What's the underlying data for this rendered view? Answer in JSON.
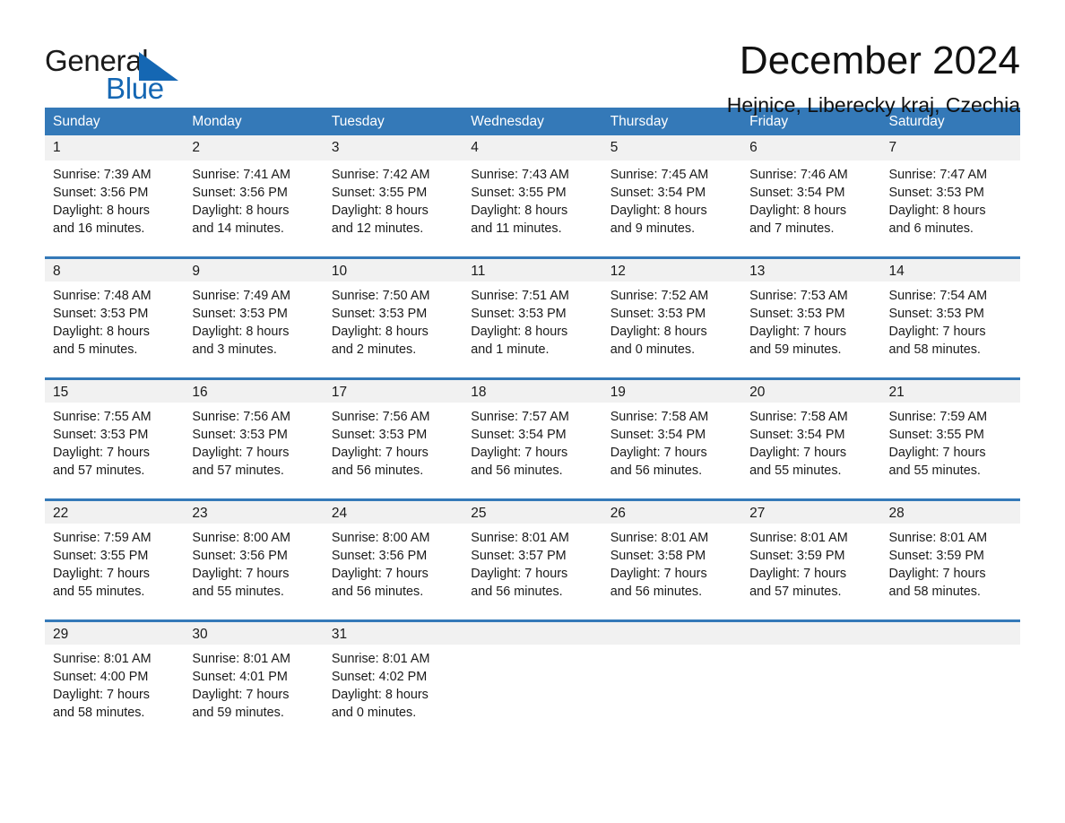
{
  "brand": {
    "name_part1": "General",
    "name_part2": "Blue",
    "triangle_icon": "triangle-icon",
    "accent_color": "#1567b3"
  },
  "header": {
    "title": "December 2024",
    "subtitle": "Hejnice, Liberecky kraj, Czechia"
  },
  "colors": {
    "header_blue": "#3479b8",
    "daynum_band": "#f1f1f1",
    "text": "#1a1a1a"
  },
  "calendar": {
    "weekdays": [
      "Sunday",
      "Monday",
      "Tuesday",
      "Wednesday",
      "Thursday",
      "Friday",
      "Saturday"
    ],
    "weeks": [
      [
        {
          "day": "1",
          "sunrise": "Sunrise: 7:39 AM",
          "sunset": "Sunset: 3:56 PM",
          "daylight_line1": "Daylight: 8 hours",
          "daylight_line2": "and 16 minutes."
        },
        {
          "day": "2",
          "sunrise": "Sunrise: 7:41 AM",
          "sunset": "Sunset: 3:56 PM",
          "daylight_line1": "Daylight: 8 hours",
          "daylight_line2": "and 14 minutes."
        },
        {
          "day": "3",
          "sunrise": "Sunrise: 7:42 AM",
          "sunset": "Sunset: 3:55 PM",
          "daylight_line1": "Daylight: 8 hours",
          "daylight_line2": "and 12 minutes."
        },
        {
          "day": "4",
          "sunrise": "Sunrise: 7:43 AM",
          "sunset": "Sunset: 3:55 PM",
          "daylight_line1": "Daylight: 8 hours",
          "daylight_line2": "and 11 minutes."
        },
        {
          "day": "5",
          "sunrise": "Sunrise: 7:45 AM",
          "sunset": "Sunset: 3:54 PM",
          "daylight_line1": "Daylight: 8 hours",
          "daylight_line2": "and 9 minutes."
        },
        {
          "day": "6",
          "sunrise": "Sunrise: 7:46 AM",
          "sunset": "Sunset: 3:54 PM",
          "daylight_line1": "Daylight: 8 hours",
          "daylight_line2": "and 7 minutes."
        },
        {
          "day": "7",
          "sunrise": "Sunrise: 7:47 AM",
          "sunset": "Sunset: 3:53 PM",
          "daylight_line1": "Daylight: 8 hours",
          "daylight_line2": "and 6 minutes."
        }
      ],
      [
        {
          "day": "8",
          "sunrise": "Sunrise: 7:48 AM",
          "sunset": "Sunset: 3:53 PM",
          "daylight_line1": "Daylight: 8 hours",
          "daylight_line2": "and 5 minutes."
        },
        {
          "day": "9",
          "sunrise": "Sunrise: 7:49 AM",
          "sunset": "Sunset: 3:53 PM",
          "daylight_line1": "Daylight: 8 hours",
          "daylight_line2": "and 3 minutes."
        },
        {
          "day": "10",
          "sunrise": "Sunrise: 7:50 AM",
          "sunset": "Sunset: 3:53 PM",
          "daylight_line1": "Daylight: 8 hours",
          "daylight_line2": "and 2 minutes."
        },
        {
          "day": "11",
          "sunrise": "Sunrise: 7:51 AM",
          "sunset": "Sunset: 3:53 PM",
          "daylight_line1": "Daylight: 8 hours",
          "daylight_line2": "and 1 minute."
        },
        {
          "day": "12",
          "sunrise": "Sunrise: 7:52 AM",
          "sunset": "Sunset: 3:53 PM",
          "daylight_line1": "Daylight: 8 hours",
          "daylight_line2": "and 0 minutes."
        },
        {
          "day": "13",
          "sunrise": "Sunrise: 7:53 AM",
          "sunset": "Sunset: 3:53 PM",
          "daylight_line1": "Daylight: 7 hours",
          "daylight_line2": "and 59 minutes."
        },
        {
          "day": "14",
          "sunrise": "Sunrise: 7:54 AM",
          "sunset": "Sunset: 3:53 PM",
          "daylight_line1": "Daylight: 7 hours",
          "daylight_line2": "and 58 minutes."
        }
      ],
      [
        {
          "day": "15",
          "sunrise": "Sunrise: 7:55 AM",
          "sunset": "Sunset: 3:53 PM",
          "daylight_line1": "Daylight: 7 hours",
          "daylight_line2": "and 57 minutes."
        },
        {
          "day": "16",
          "sunrise": "Sunrise: 7:56 AM",
          "sunset": "Sunset: 3:53 PM",
          "daylight_line1": "Daylight: 7 hours",
          "daylight_line2": "and 57 minutes."
        },
        {
          "day": "17",
          "sunrise": "Sunrise: 7:56 AM",
          "sunset": "Sunset: 3:53 PM",
          "daylight_line1": "Daylight: 7 hours",
          "daylight_line2": "and 56 minutes."
        },
        {
          "day": "18",
          "sunrise": "Sunrise: 7:57 AM",
          "sunset": "Sunset: 3:54 PM",
          "daylight_line1": "Daylight: 7 hours",
          "daylight_line2": "and 56 minutes."
        },
        {
          "day": "19",
          "sunrise": "Sunrise: 7:58 AM",
          "sunset": "Sunset: 3:54 PM",
          "daylight_line1": "Daylight: 7 hours",
          "daylight_line2": "and 56 minutes."
        },
        {
          "day": "20",
          "sunrise": "Sunrise: 7:58 AM",
          "sunset": "Sunset: 3:54 PM",
          "daylight_line1": "Daylight: 7 hours",
          "daylight_line2": "and 55 minutes."
        },
        {
          "day": "21",
          "sunrise": "Sunrise: 7:59 AM",
          "sunset": "Sunset: 3:55 PM",
          "daylight_line1": "Daylight: 7 hours",
          "daylight_line2": "and 55 minutes."
        }
      ],
      [
        {
          "day": "22",
          "sunrise": "Sunrise: 7:59 AM",
          "sunset": "Sunset: 3:55 PM",
          "daylight_line1": "Daylight: 7 hours",
          "daylight_line2": "and 55 minutes."
        },
        {
          "day": "23",
          "sunrise": "Sunrise: 8:00 AM",
          "sunset": "Sunset: 3:56 PM",
          "daylight_line1": "Daylight: 7 hours",
          "daylight_line2": "and 55 minutes."
        },
        {
          "day": "24",
          "sunrise": "Sunrise: 8:00 AM",
          "sunset": "Sunset: 3:56 PM",
          "daylight_line1": "Daylight: 7 hours",
          "daylight_line2": "and 56 minutes."
        },
        {
          "day": "25",
          "sunrise": "Sunrise: 8:01 AM",
          "sunset": "Sunset: 3:57 PM",
          "daylight_line1": "Daylight: 7 hours",
          "daylight_line2": "and 56 minutes."
        },
        {
          "day": "26",
          "sunrise": "Sunrise: 8:01 AM",
          "sunset": "Sunset: 3:58 PM",
          "daylight_line1": "Daylight: 7 hours",
          "daylight_line2": "and 56 minutes."
        },
        {
          "day": "27",
          "sunrise": "Sunrise: 8:01 AM",
          "sunset": "Sunset: 3:59 PM",
          "daylight_line1": "Daylight: 7 hours",
          "daylight_line2": "and 57 minutes."
        },
        {
          "day": "28",
          "sunrise": "Sunrise: 8:01 AM",
          "sunset": "Sunset: 3:59 PM",
          "daylight_line1": "Daylight: 7 hours",
          "daylight_line2": "and 58 minutes."
        }
      ],
      [
        {
          "day": "29",
          "sunrise": "Sunrise: 8:01 AM",
          "sunset": "Sunset: 4:00 PM",
          "daylight_line1": "Daylight: 7 hours",
          "daylight_line2": "and 58 minutes."
        },
        {
          "day": "30",
          "sunrise": "Sunrise: 8:01 AM",
          "sunset": "Sunset: 4:01 PM",
          "daylight_line1": "Daylight: 7 hours",
          "daylight_line2": "and 59 minutes."
        },
        {
          "day": "31",
          "sunrise": "Sunrise: 8:01 AM",
          "sunset": "Sunset: 4:02 PM",
          "daylight_line1": "Daylight: 8 hours",
          "daylight_line2": "and 0 minutes."
        },
        {
          "day": "",
          "sunrise": "",
          "sunset": "",
          "daylight_line1": "",
          "daylight_line2": ""
        },
        {
          "day": "",
          "sunrise": "",
          "sunset": "",
          "daylight_line1": "",
          "daylight_line2": ""
        },
        {
          "day": "",
          "sunrise": "",
          "sunset": "",
          "daylight_line1": "",
          "daylight_line2": ""
        },
        {
          "day": "",
          "sunrise": "",
          "sunset": "",
          "daylight_line1": "",
          "daylight_line2": ""
        }
      ]
    ]
  }
}
